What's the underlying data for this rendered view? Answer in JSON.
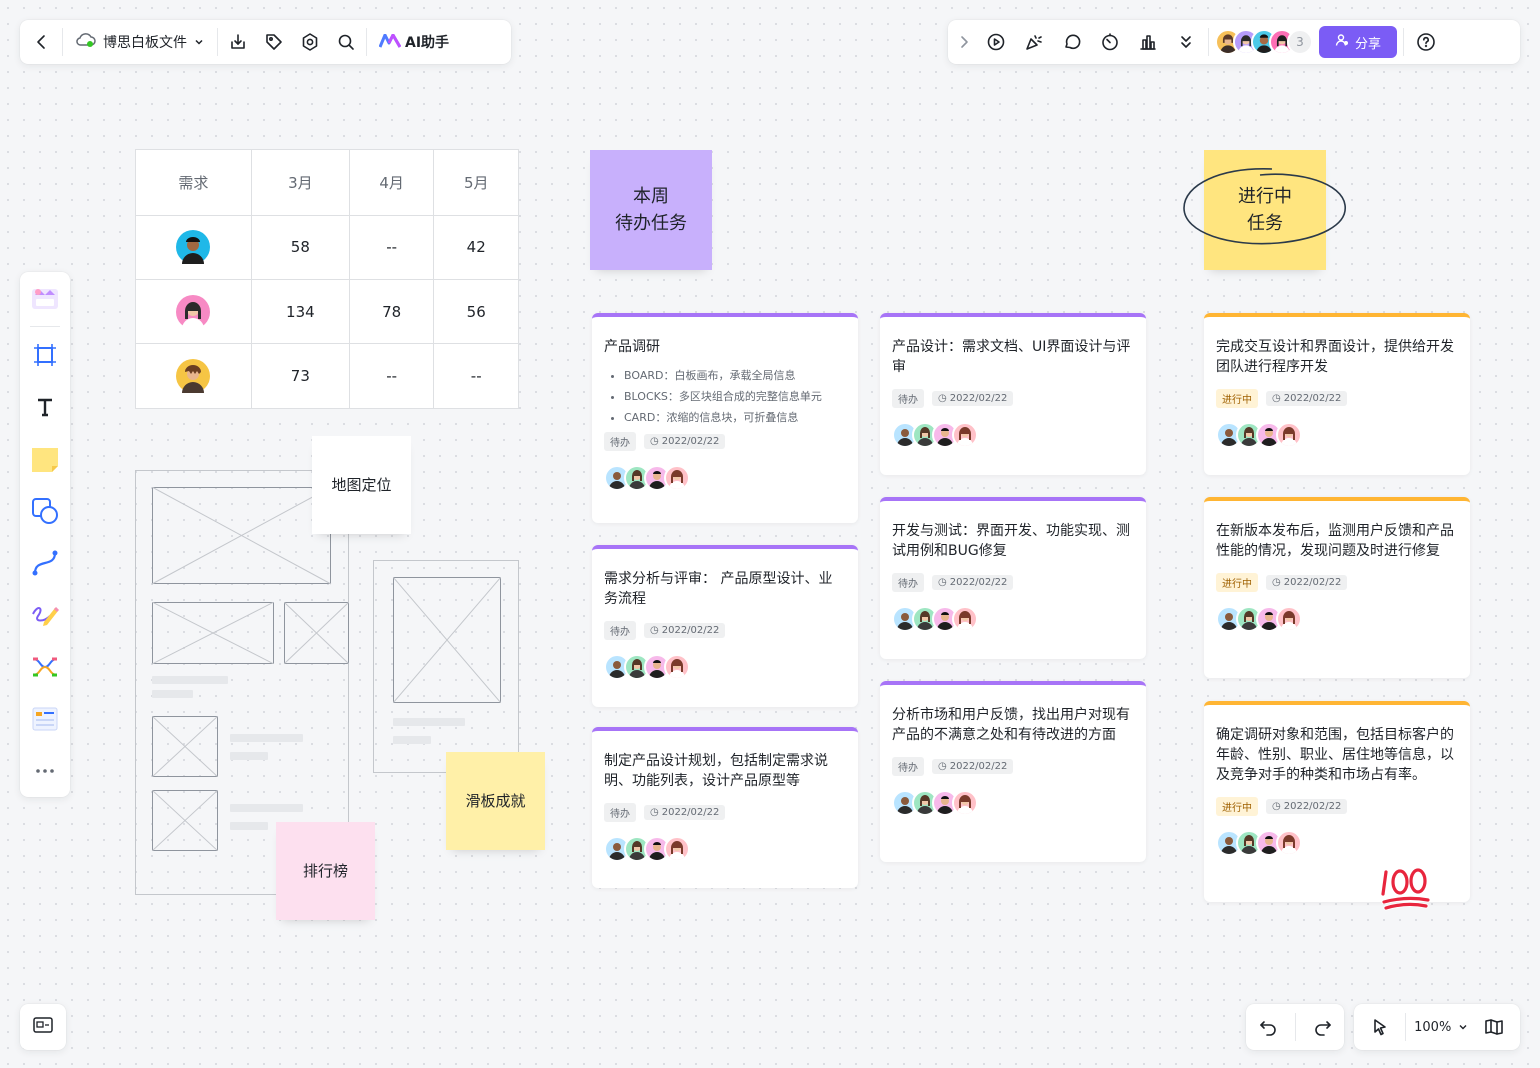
{
  "toolbar": {
    "file_name": "博思白板文件",
    "ai_label": "AI助手",
    "collaborator_count": "3",
    "share_label": "分享"
  },
  "table": {
    "headers": [
      "需求",
      "3月",
      "4月",
      "5月"
    ],
    "rows": [
      [
        "58",
        "--",
        "42"
      ],
      [
        "134",
        "78",
        "56"
      ],
      [
        "73",
        "--",
        "--"
      ]
    ]
  },
  "stickies": {
    "week_todo": [
      "本周",
      "待办任务"
    ],
    "in_progress": [
      "进行中",
      "任务"
    ],
    "map": "地图定位",
    "skate": "滑板成就",
    "rank": "排行榜"
  },
  "cards": {
    "c1": {
      "title": "产品调研",
      "bullets": [
        "BOARD：白板画布，承载全局信息",
        "BLOCKS：多区块组合成的完整信息单元",
        "CARD：浓缩的信息块，可折叠信息"
      ],
      "status": "待办",
      "date": "2022/02/22"
    },
    "c2": {
      "title": "需求分析与评审： 产品原型设计、业务流程",
      "status": "待办",
      "date": "2022/02/22"
    },
    "c3": {
      "title": "制定产品设计规划，包括制定需求说明、功能列表，设计产品原型等",
      "status": "待办",
      "date": "2022/02/22"
    },
    "c4": {
      "title": "产品设计：需求文档、UI界面设计与评审",
      "status": "待办",
      "date": "2022/02/22"
    },
    "c5": {
      "title": "开发与测试：界面开发、功能实现、测试用例和BUG修复",
      "status": "待办",
      "date": "2022/02/22"
    },
    "c6": {
      "title": "分析市场和用户反馈，找出用户对现有产品的不满意之处和有待改进的方面",
      "status": "待办",
      "date": "2022/02/22"
    },
    "c7": {
      "title": "完成交互设计和界面设计，提供给开发团队进行程序开发",
      "status": "进行中",
      "date": "2022/02/22"
    },
    "c8": {
      "title": "在新版本发布后，监测用户反馈和产品性能的情况，发现问题及时进行修复",
      "status": "进行中",
      "date": "2022/02/22"
    },
    "c9": {
      "title": "确定调研对象和范围，包括目标客户的年龄、性别、职业、居住地等信息，以及竞争对手的种类和市场占有率。",
      "status": "进行中",
      "date": "2022/02/22"
    }
  },
  "zoom": {
    "level": "100%"
  },
  "colors": {
    "accent": "#7b5cf5",
    "card_purple": "#a774f7",
    "card_orange": "#ffb533",
    "sticky_purple": "#c8b0fc",
    "sticky_yellow": "#ffe57f",
    "sticky_pink": "#fde0ef"
  }
}
